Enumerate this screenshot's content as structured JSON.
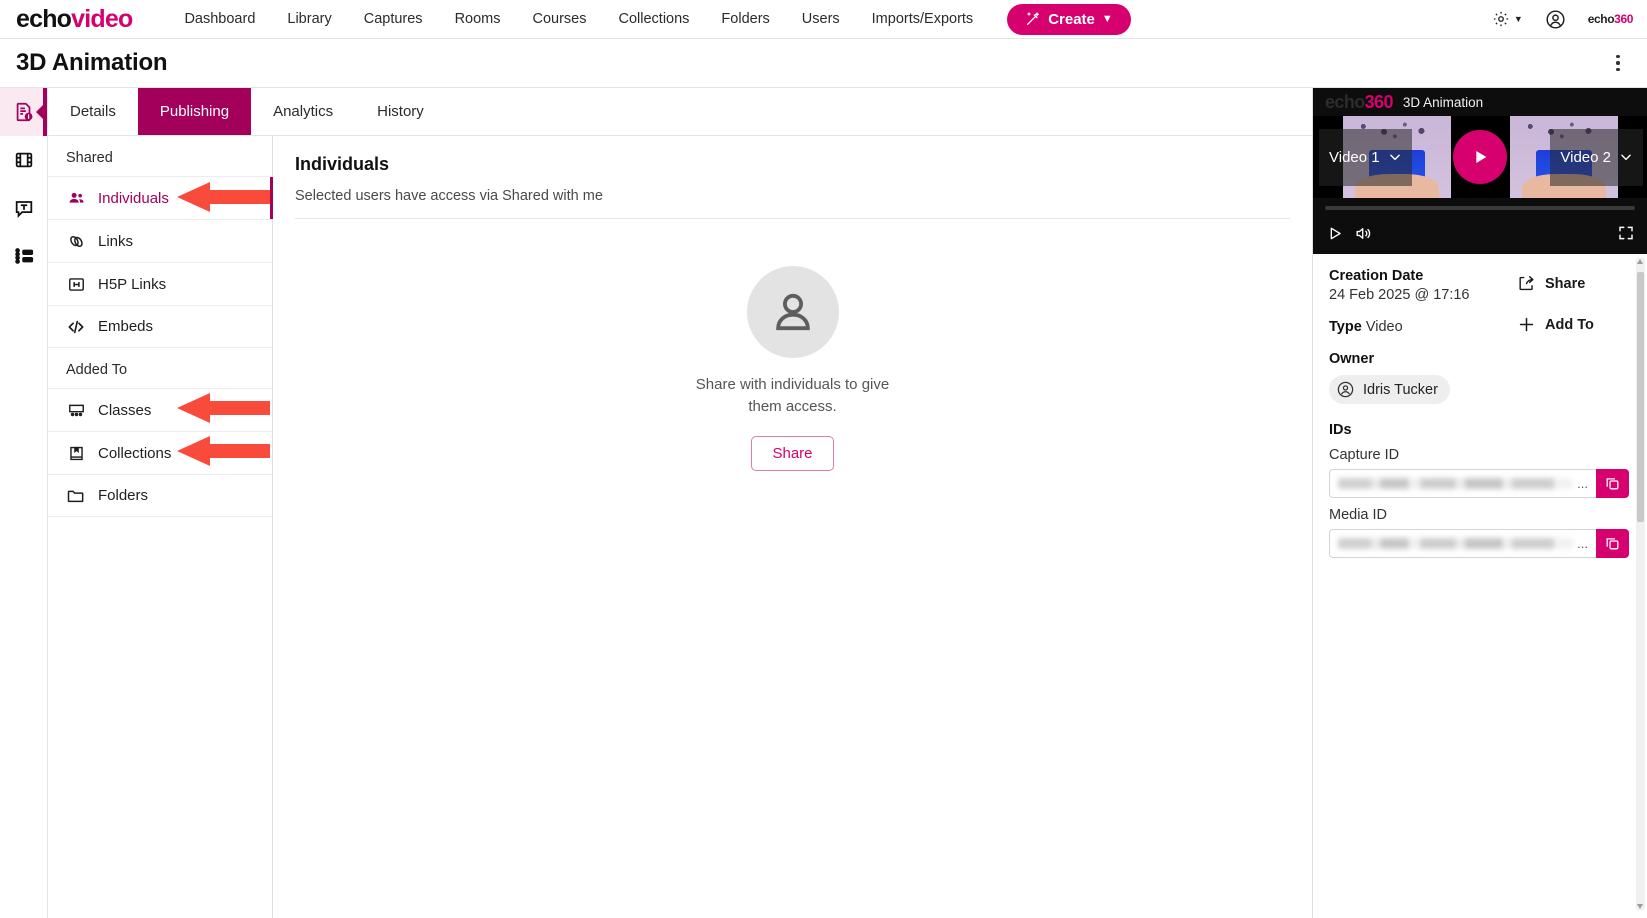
{
  "brand": {
    "part1": "echo",
    "part2": "video",
    "mini1": "echo",
    "mini2": "360"
  },
  "topnav": {
    "links": [
      "Dashboard",
      "Library",
      "Captures",
      "Rooms",
      "Courses",
      "Collections",
      "Folders",
      "Users",
      "Imports/Exports"
    ],
    "create_label": "Create",
    "create_color": "#d6006e",
    "gear_icon": "gear-icon",
    "account_icon": "account-circle-icon"
  },
  "header": {
    "title": "3D Animation",
    "overflow_icon": "kebab-menu-icon"
  },
  "rail": {
    "items": [
      {
        "name": "media-info-icon",
        "active": true
      },
      {
        "name": "filmstrip-icon",
        "active": false
      },
      {
        "name": "transcript-icon",
        "active": false
      },
      {
        "name": "list-settings-icon",
        "active": false
      }
    ]
  },
  "tabs": [
    {
      "label": "Details",
      "active": false
    },
    {
      "label": "Publishing",
      "active": true
    },
    {
      "label": "Analytics",
      "active": false
    },
    {
      "label": "History",
      "active": false
    }
  ],
  "subnav": {
    "group_shared": "Shared",
    "group_added_to": "Added To",
    "items": [
      {
        "label": "Individuals",
        "icon": "people-group-icon",
        "selected": true,
        "annotated": true
      },
      {
        "label": "Links",
        "icon": "link-chain-icon",
        "selected": false,
        "annotated": false
      },
      {
        "label": "H5P Links",
        "icon": "h5p-icon",
        "selected": false,
        "annotated": false
      },
      {
        "label": "Embeds",
        "icon": "code-brackets-icon",
        "selected": false,
        "annotated": false
      }
    ],
    "items2": [
      {
        "label": "Classes",
        "icon": "classroom-icon",
        "selected": false,
        "annotated": true
      },
      {
        "label": "Collections",
        "icon": "book-bookmark-icon",
        "selected": false,
        "annotated": true
      },
      {
        "label": "Folders",
        "icon": "folder-icon",
        "selected": false,
        "annotated": false
      }
    ]
  },
  "annotation": {
    "arrow_color": "#f94b3c",
    "count": 3
  },
  "main": {
    "title": "Individuals",
    "subtitle": "Selected users have access via Shared with me",
    "empty_icon": "person-avatar-icon",
    "empty_message": "Share with individuals to give them access.",
    "share_button": "Share"
  },
  "player": {
    "logo1": "echo",
    "logo2": "360",
    "title": "3D Animation",
    "video_left_label": "Video 1",
    "video_right_label": "Video 2",
    "play_overlay_icon": "play-circle-icon",
    "play_icon": "play-icon",
    "volume_icon": "volume-icon",
    "fullscreen_icon": "fullscreen-icon",
    "accent": "#d6006e"
  },
  "details": {
    "creation_date_label": "Creation Date",
    "creation_date_value": "24 Feb 2025 @ 17:16",
    "type_label": "Type",
    "type_value": "Video",
    "owner_label": "Owner",
    "owner_name": "Idris Tucker",
    "owner_icon": "user-circle-icon",
    "share_action": "Share",
    "share_icon": "share-arrow-icon",
    "addto_action": "Add To",
    "addto_icon": "plus-icon",
    "ids_title": "IDs",
    "capture_id_label": "Capture ID",
    "capture_id_value": "",
    "media_id_label": "Media ID",
    "media_id_value": "",
    "ellipsis": "...",
    "copy_icon": "copy-icon"
  }
}
